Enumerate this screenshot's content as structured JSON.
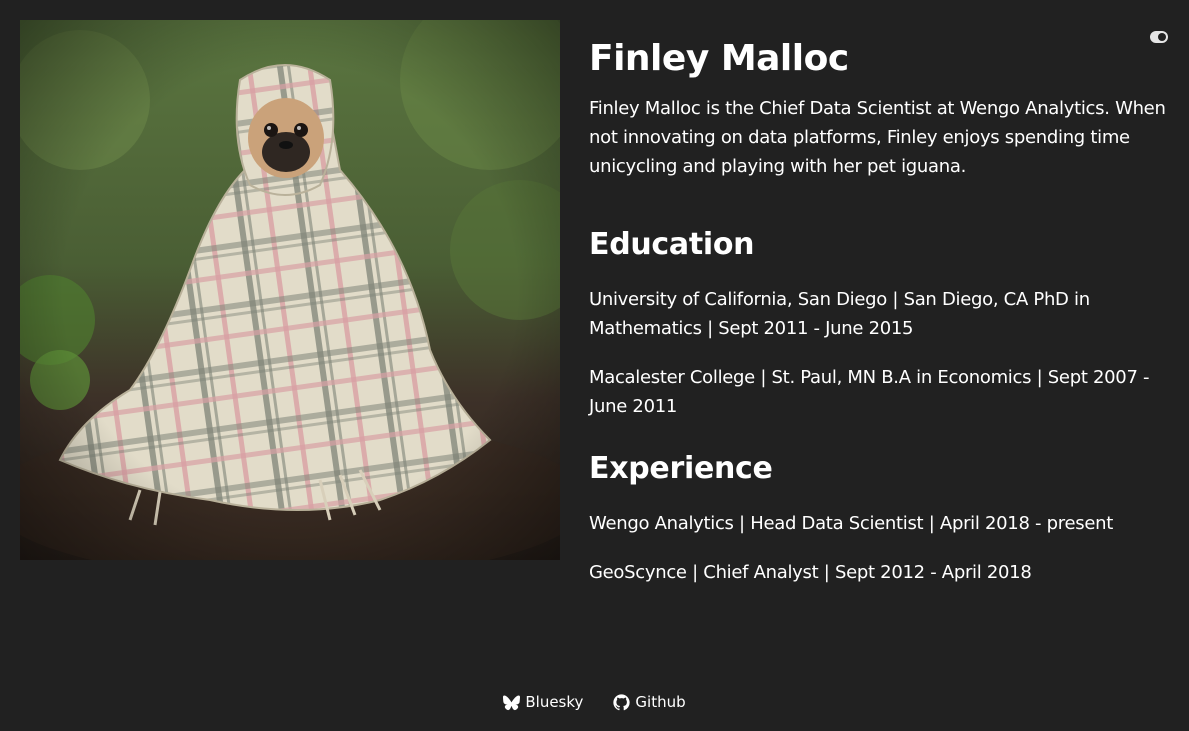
{
  "profile": {
    "name": "Finley Malloc",
    "bio": "Finley Malloc is the Chief Data Scientist at Wengo Analytics. When not innovating on data platforms, Finley enjoys spending time unicycling and playing with her pet iguana.",
    "photo_icon": "pug-in-blanket-photo"
  },
  "education": {
    "title": "Education",
    "items": [
      "University of California, San Diego | San Diego, CA PhD in Mathematics | Sept 2011 - June 2015",
      "Macalester College | St. Paul, MN B.A in Economics | Sept 2007 - June 2011"
    ]
  },
  "experience": {
    "title": "Experience",
    "items": [
      "Wengo Analytics | Head Data Scientist | April 2018 - present",
      "GeoScynce | Chief Analyst | Sept 2012 - April 2018"
    ]
  },
  "footer": {
    "links": [
      {
        "label": "Bluesky",
        "icon": "bluesky-icon"
      },
      {
        "label": "Github",
        "icon": "github-icon"
      }
    ]
  },
  "theme_toggle": {
    "icon": "toggle-icon"
  },
  "colors": {
    "background": "#212121",
    "text": "#ffffff"
  }
}
